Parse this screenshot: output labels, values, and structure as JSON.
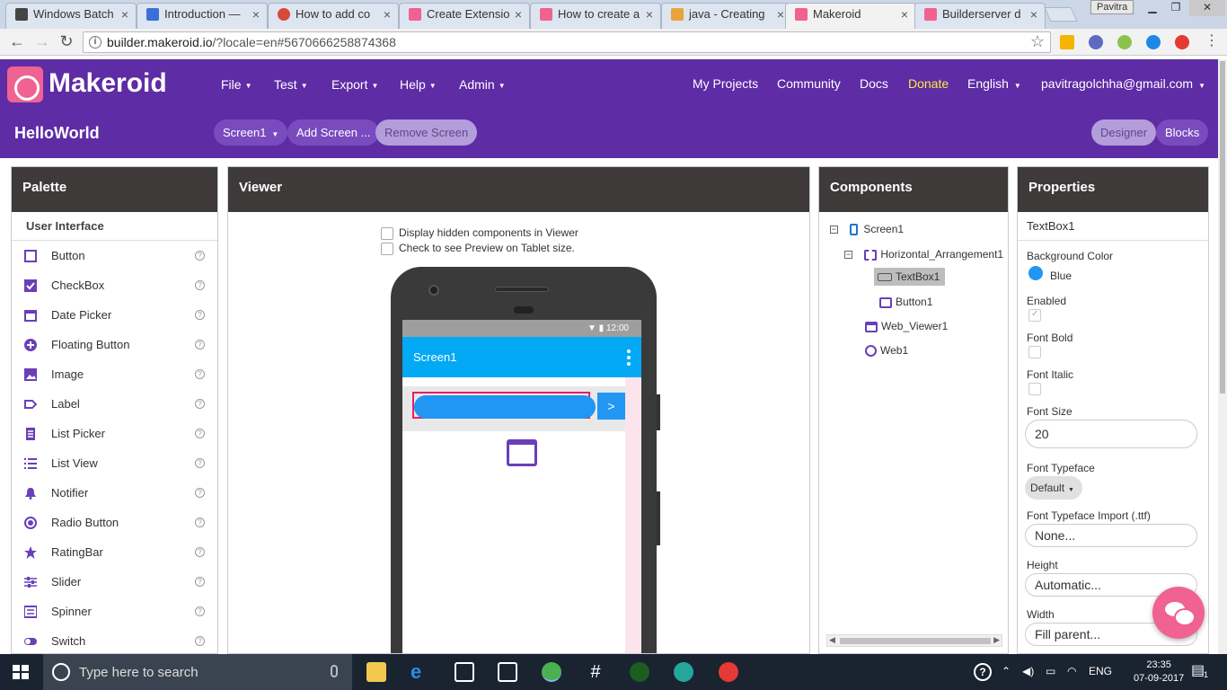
{
  "browser": {
    "tabs": [
      {
        "label": "Windows Batch",
        "favicon_color": "#444444"
      },
      {
        "label": "Introduction —",
        "favicon_color": "#3b6fd9"
      },
      {
        "label": "How to add co",
        "favicon_color": "#d84a38"
      },
      {
        "label": "Create Extensio",
        "favicon_color": "#f06292"
      },
      {
        "label": "How to create a",
        "favicon_color": "#f06292"
      },
      {
        "label": "java - Creating",
        "favicon_color": "#e8a33c"
      },
      {
        "label": "Makeroid",
        "favicon_color": "#f06292",
        "active": true
      },
      {
        "label": "Builderserver d",
        "favicon_color": "#f06292"
      }
    ],
    "user_chip": "Pavitra",
    "url_host": "builder.makeroid.io",
    "url_path": "/?locale=en#5670666258874368"
  },
  "app": {
    "logo": "Makeroid",
    "menus": [
      {
        "label": "File"
      },
      {
        "label": "Test"
      },
      {
        "label": "Export"
      },
      {
        "label": "Help"
      },
      {
        "label": "Admin"
      }
    ],
    "links": {
      "my_projects": "My Projects",
      "community": "Community",
      "docs": "Docs",
      "donate": "Donate",
      "language": "English",
      "account": "pavitragolchha@gmail.com"
    },
    "project_title": "HelloWorld",
    "screen_select": "Screen1",
    "add_screen": "Add Screen ...",
    "remove_screen": "Remove Screen",
    "designer": "Designer",
    "blocks": "Blocks",
    "accent_color": "#5e2ca5"
  },
  "palette": {
    "title": "Palette",
    "category": "User Interface",
    "items": [
      {
        "label": "Button",
        "icon": "button-icon"
      },
      {
        "label": "CheckBox",
        "icon": "checkbox-icon"
      },
      {
        "label": "Date Picker",
        "icon": "calendar-icon"
      },
      {
        "label": "Floating Button",
        "icon": "plus-circle-icon"
      },
      {
        "label": "Image",
        "icon": "image-icon"
      },
      {
        "label": "Label",
        "icon": "label-icon"
      },
      {
        "label": "List Picker",
        "icon": "list-picker-icon"
      },
      {
        "label": "List View",
        "icon": "list-view-icon"
      },
      {
        "label": "Notifier",
        "icon": "bell-icon"
      },
      {
        "label": "Radio Button",
        "icon": "radio-icon"
      },
      {
        "label": "RatingBar",
        "icon": "star-icon"
      },
      {
        "label": "Slider",
        "icon": "slider-icon"
      },
      {
        "label": "Spinner",
        "icon": "spinner-icon"
      },
      {
        "label": "Switch",
        "icon": "switch-icon"
      }
    ],
    "help_glyph": "?"
  },
  "viewer": {
    "title": "Viewer",
    "option_hidden": "Display hidden components in Viewer",
    "option_tablet": "Check to see Preview on Tablet size.",
    "status_time": "12:00",
    "screen_title": "Screen1",
    "button_text": ">"
  },
  "components": {
    "title": "Components",
    "tree": [
      {
        "label": "Screen1",
        "toggle": "−"
      },
      {
        "label": "Horizontal_Arrangement1",
        "toggle": "−"
      },
      {
        "label": "TextBox1",
        "selected": true
      },
      {
        "label": "Button1"
      },
      {
        "label": "Web_Viewer1"
      },
      {
        "label": "Web1"
      }
    ]
  },
  "properties": {
    "title": "Properties",
    "component": "TextBox1",
    "background_color_label": "Background Color",
    "background_color_value": "Blue",
    "enabled_label": "Enabled",
    "enabled": true,
    "font_bold_label": "Font Bold",
    "font_italic_label": "Font Italic",
    "font_size_label": "Font Size",
    "font_size_value": "20",
    "font_typeface_label": "Font Typeface",
    "font_typeface_value": "Default",
    "font_import_label": "Font Typeface Import (.ttf)",
    "font_import_value": "None...",
    "height_label": "Height",
    "height_value": "Automatic...",
    "width_label": "Width",
    "width_value": "Fill parent..."
  },
  "taskbar": {
    "search_placeholder": "Type here to search",
    "language": "ENG",
    "time": "23:35",
    "date": "07-09-2017",
    "notification_count": "1"
  }
}
